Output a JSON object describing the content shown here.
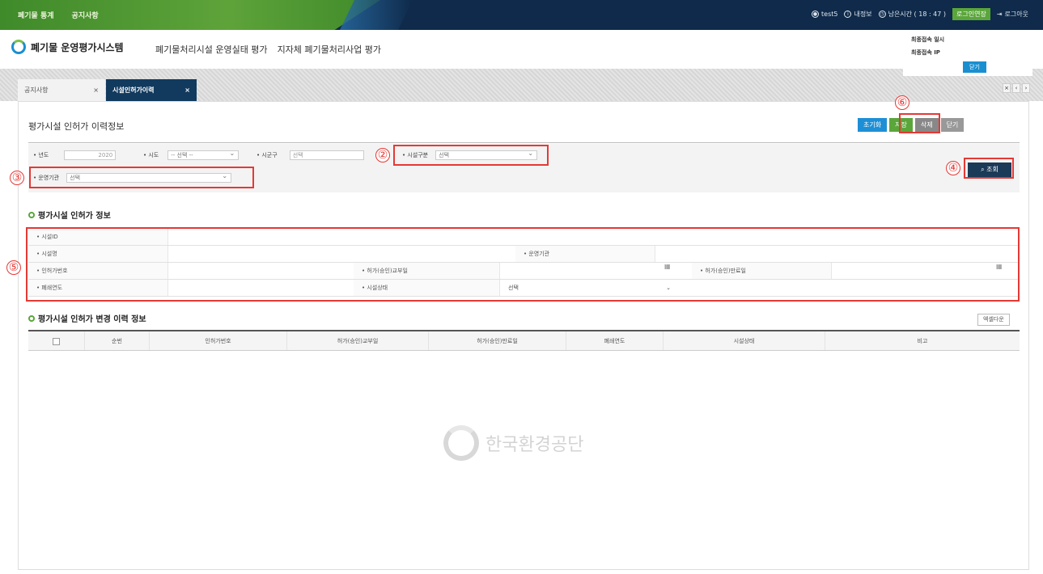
{
  "topbar": {
    "nav": [
      "폐기물 통계",
      "공지사항"
    ],
    "user": "test5",
    "myinfo": "내정보",
    "session": "남은시간 ( 18 : 47 )",
    "extend": "로그인연장",
    "logout": "로그아웃"
  },
  "header": {
    "logo": "폐기물 운영평가시스템",
    "menu": [
      "폐기물처리시설 운영실태 평가",
      "지자체 폐기물처리사업 평가"
    ]
  },
  "last_login": {
    "time_label": "최종접속 일시",
    "ip_label": "최종접속 IP",
    "close": "닫기"
  },
  "tabs": {
    "tab1": "공지사항",
    "tab2": "시설인허가이력",
    "close": "×"
  },
  "page": {
    "title": "평가시설 인허가 이력정보",
    "actions": {
      "new": "초기화",
      "save": "저장",
      "delete": "삭제",
      "close": "닫기"
    }
  },
  "search": {
    "year_label": "년도",
    "year_value": "2020",
    "sido_label": "시도",
    "sido_value": "-- 선택 --",
    "sigungu_label": "시군구",
    "sigungu_value": "선택",
    "facility_type_label": "시설구분",
    "facility_type_value": "선택",
    "operator_label": "운영기관",
    "operator_value": "선택",
    "search_button": "조회"
  },
  "annotations": [
    "②",
    "③",
    "④",
    "⑤",
    "⑥"
  ],
  "info_section": {
    "title": "평가시설 인허가 정보",
    "facility_id": "시설ID",
    "facility_name": "시설명",
    "operator": "운영기관",
    "permit_no": "인허가번호",
    "permit_date": "허가(승인)교부일",
    "permit_expiry": "허가(승인)만료일",
    "closure_year": "폐쇄연도",
    "facility_status": "시설상태",
    "facility_status_value": "선택"
  },
  "history_section": {
    "title": "평가시설 인허가 변경 이력 정보",
    "excel": "엑셀다운",
    "columns": [
      "순번",
      "인허가번호",
      "허가(승인)교부일",
      "허가(승인)만료일",
      "폐쇄연도",
      "시설상태",
      "비고"
    ],
    "watermark": "한국환경공단"
  }
}
